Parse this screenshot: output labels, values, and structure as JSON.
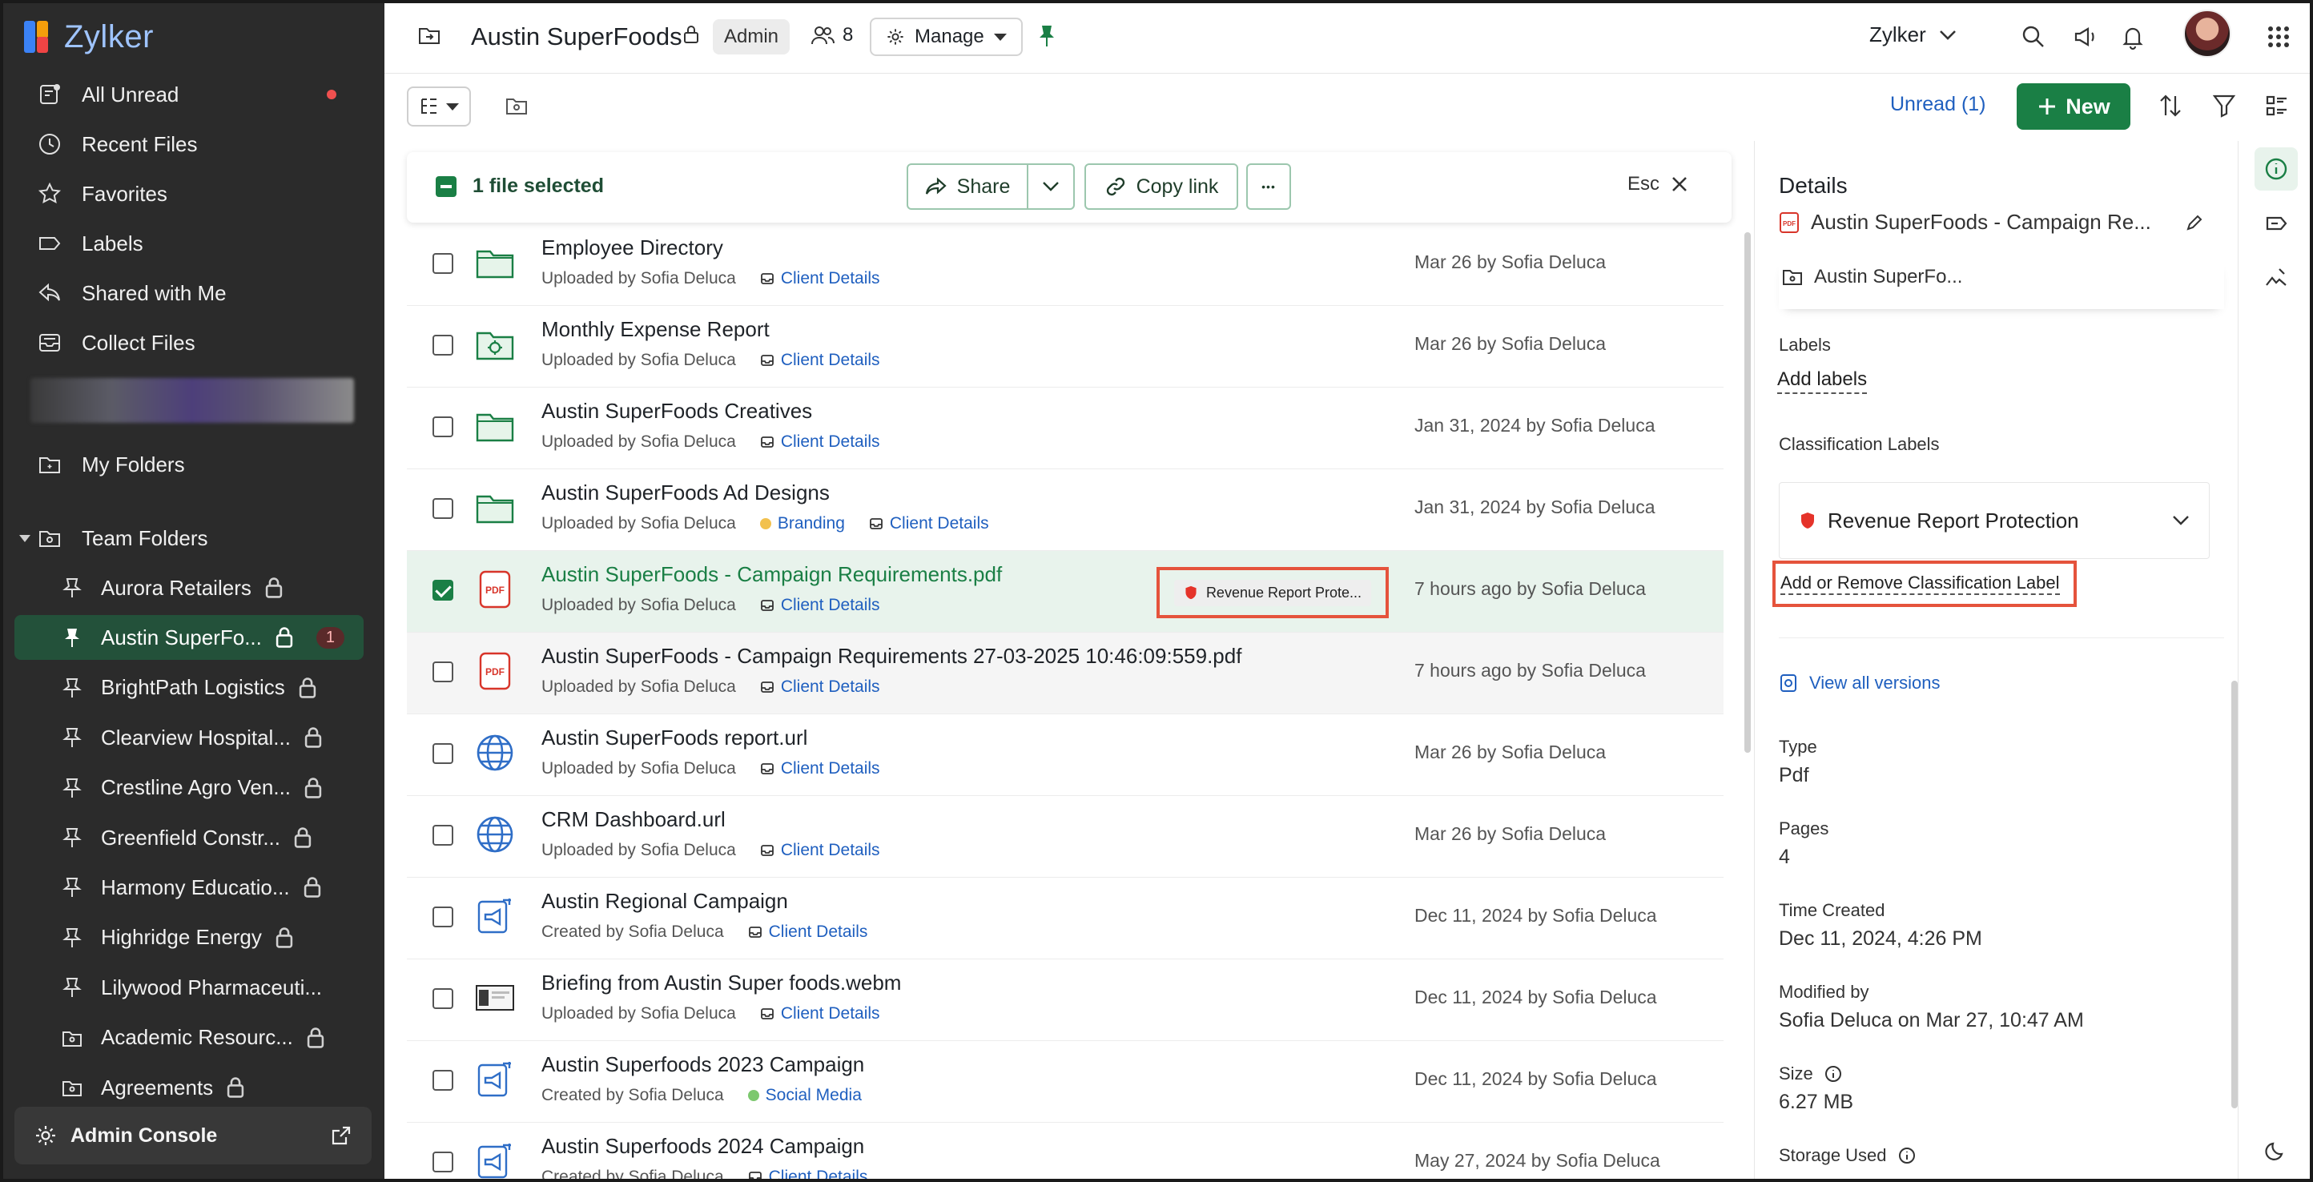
{
  "app": {
    "brand": "Zylker"
  },
  "sidebar": {
    "nav": [
      {
        "label": "All Unread",
        "icon": "unread-icon",
        "dot": true
      },
      {
        "label": "Recent Files",
        "icon": "clock-icon"
      },
      {
        "label": "Favorites",
        "icon": "star-icon"
      },
      {
        "label": "Labels",
        "icon": "label-icon"
      },
      {
        "label": "Shared with Me",
        "icon": "share-back-icon"
      },
      {
        "label": "Collect Files",
        "icon": "inbox-icon"
      }
    ],
    "my_folders": "My Folders",
    "team_folders": "Team Folders",
    "teams": [
      {
        "label": "Aurora Retailers",
        "locked": true
      },
      {
        "label": "Austin SuperFo...",
        "locked": true,
        "count": "1",
        "active": true
      },
      {
        "label": "BrightPath Logistics",
        "locked": true
      },
      {
        "label": "Clearview Hospital...",
        "locked": true
      },
      {
        "label": "Crestline Agro Ven...",
        "locked": true
      },
      {
        "label": "Greenfield Constr...",
        "locked": true
      },
      {
        "label": "Harmony Educatio...",
        "locked": true
      },
      {
        "label": "Highridge Energy",
        "locked": true
      },
      {
        "label": "Lilywood Pharmaceuti...",
        "locked": false
      },
      {
        "label": "Academic Resourc...",
        "locked": true,
        "type": "folder"
      },
      {
        "label": "Agreements",
        "locked": true,
        "type": "folder"
      }
    ],
    "admin_console": "Admin Console"
  },
  "topbar": {
    "title": "Austin SuperFoods",
    "role": "Admin",
    "members": "8",
    "manage": "Manage",
    "org": "Zylker"
  },
  "toolbar": {
    "unread": "Unread (1)",
    "new": "New"
  },
  "selection": {
    "text": "1 file selected",
    "share": "Share",
    "copy_link": "Copy link",
    "more": "•••",
    "esc": "Esc"
  },
  "files": [
    {
      "name": "Employee Directory",
      "meta": "Uploaded by Sofia Deluca",
      "tags": [
        {
          "label": "Client Details",
          "kind": "box"
        }
      ],
      "date": "Mar 26 by Sofia Deluca",
      "icon": "folder"
    },
    {
      "name": "Monthly Expense Report",
      "meta": "Uploaded by Sofia Deluca",
      "tags": [
        {
          "label": "Client Details",
          "kind": "box"
        }
      ],
      "date": "Mar 26 by Sofia Deluca",
      "icon": "shared-folder"
    },
    {
      "name": "Austin SuperFoods Creatives",
      "meta": "Uploaded by Sofia Deluca",
      "tags": [
        {
          "label": "Client Details",
          "kind": "box"
        }
      ],
      "date": "Jan 31, 2024 by Sofia Deluca",
      "icon": "folder"
    },
    {
      "name": "Austin SuperFoods Ad Designs",
      "meta": "Uploaded by Sofia Deluca",
      "tags": [
        {
          "label": "Branding",
          "kind": "dot",
          "color": "#f2c14e"
        },
        {
          "label": "Client Details",
          "kind": "box"
        }
      ],
      "date": "Jan 31, 2024 by Sofia Deluca",
      "icon": "folder"
    },
    {
      "name": "Austin SuperFoods - Campaign Requirements.pdf",
      "meta": "Uploaded by Sofia Deluca",
      "tags": [
        {
          "label": "Client Details",
          "kind": "box"
        }
      ],
      "date": "7 hours ago by Sofia Deluca",
      "icon": "pdf",
      "selected": true,
      "classification": "Revenue Report Prote..."
    },
    {
      "name": "Austin SuperFoods - Campaign Requirements 27-03-2025 10:46:09:559.pdf",
      "meta": "Uploaded by Sofia Deluca",
      "tags": [
        {
          "label": "Client Details",
          "kind": "box"
        }
      ],
      "date": "7 hours ago by Sofia Deluca",
      "icon": "pdf",
      "hover": true
    },
    {
      "name": "Austin SuperFoods report.url",
      "meta": "Uploaded by Sofia Deluca",
      "tags": [
        {
          "label": "Client Details",
          "kind": "box"
        }
      ],
      "date": "Mar 26 by Sofia Deluca",
      "icon": "globe"
    },
    {
      "name": "CRM Dashboard.url",
      "meta": "Uploaded by Sofia Deluca",
      "tags": [
        {
          "label": "Client Details",
          "kind": "box"
        }
      ],
      "date": "Mar 26 by Sofia Deluca",
      "icon": "globe"
    },
    {
      "name": "Austin Regional Campaign",
      "meta": "Created by Sofia Deluca",
      "tags": [
        {
          "label": "Client Details",
          "kind": "box"
        }
      ],
      "date": "Dec 11, 2024 by Sofia Deluca",
      "icon": "campaign"
    },
    {
      "name": "Briefing from Austin Super foods.webm",
      "meta": "Uploaded by Sofia Deluca",
      "tags": [
        {
          "label": "Client Details",
          "kind": "box"
        }
      ],
      "date": "Dec 11, 2024 by Sofia Deluca",
      "icon": "video"
    },
    {
      "name": "Austin Superfoods 2023 Campaign",
      "meta": "Created by Sofia Deluca",
      "tags": [
        {
          "label": "Social Media",
          "kind": "dot",
          "color": "#7cc86e"
        }
      ],
      "date": "Dec 11, 2024 by Sofia Deluca",
      "icon": "campaign"
    },
    {
      "name": "Austin Superfoods 2024 Campaign",
      "meta": "Created by Sofia Deluca",
      "tags": [
        {
          "label": "Client Details",
          "kind": "box"
        }
      ],
      "date": "May 27, 2024 by Sofia Deluca",
      "icon": "campaign"
    }
  ],
  "details": {
    "heading": "Details",
    "file_name": "Austin SuperFoods - Campaign Re...",
    "folder": "Austin SuperFo...",
    "labels_title": "Labels",
    "add_labels": "Add labels",
    "classification_title": "Classification Labels",
    "classification_value": "Revenue Report Protection",
    "add_remove": "Add or Remove Classification Label",
    "view_versions": "View all versions",
    "type_label": "Type",
    "type_value": "Pdf",
    "pages_label": "Pages",
    "pages_value": "4",
    "created_label": "Time Created",
    "created_value": "Dec 11, 2024, 4:26 PM",
    "modified_label": "Modified by",
    "modified_value": "Sofia Deluca on Mar 27, 10:47 AM",
    "size_label": "Size",
    "size_value": "6.27 MB",
    "storage_label": "Storage Used"
  },
  "colors": {
    "accent": "#1a7f45",
    "highlight": "#e5533c",
    "link": "#1f5fbf",
    "sidebar": "#2b2b2b"
  }
}
